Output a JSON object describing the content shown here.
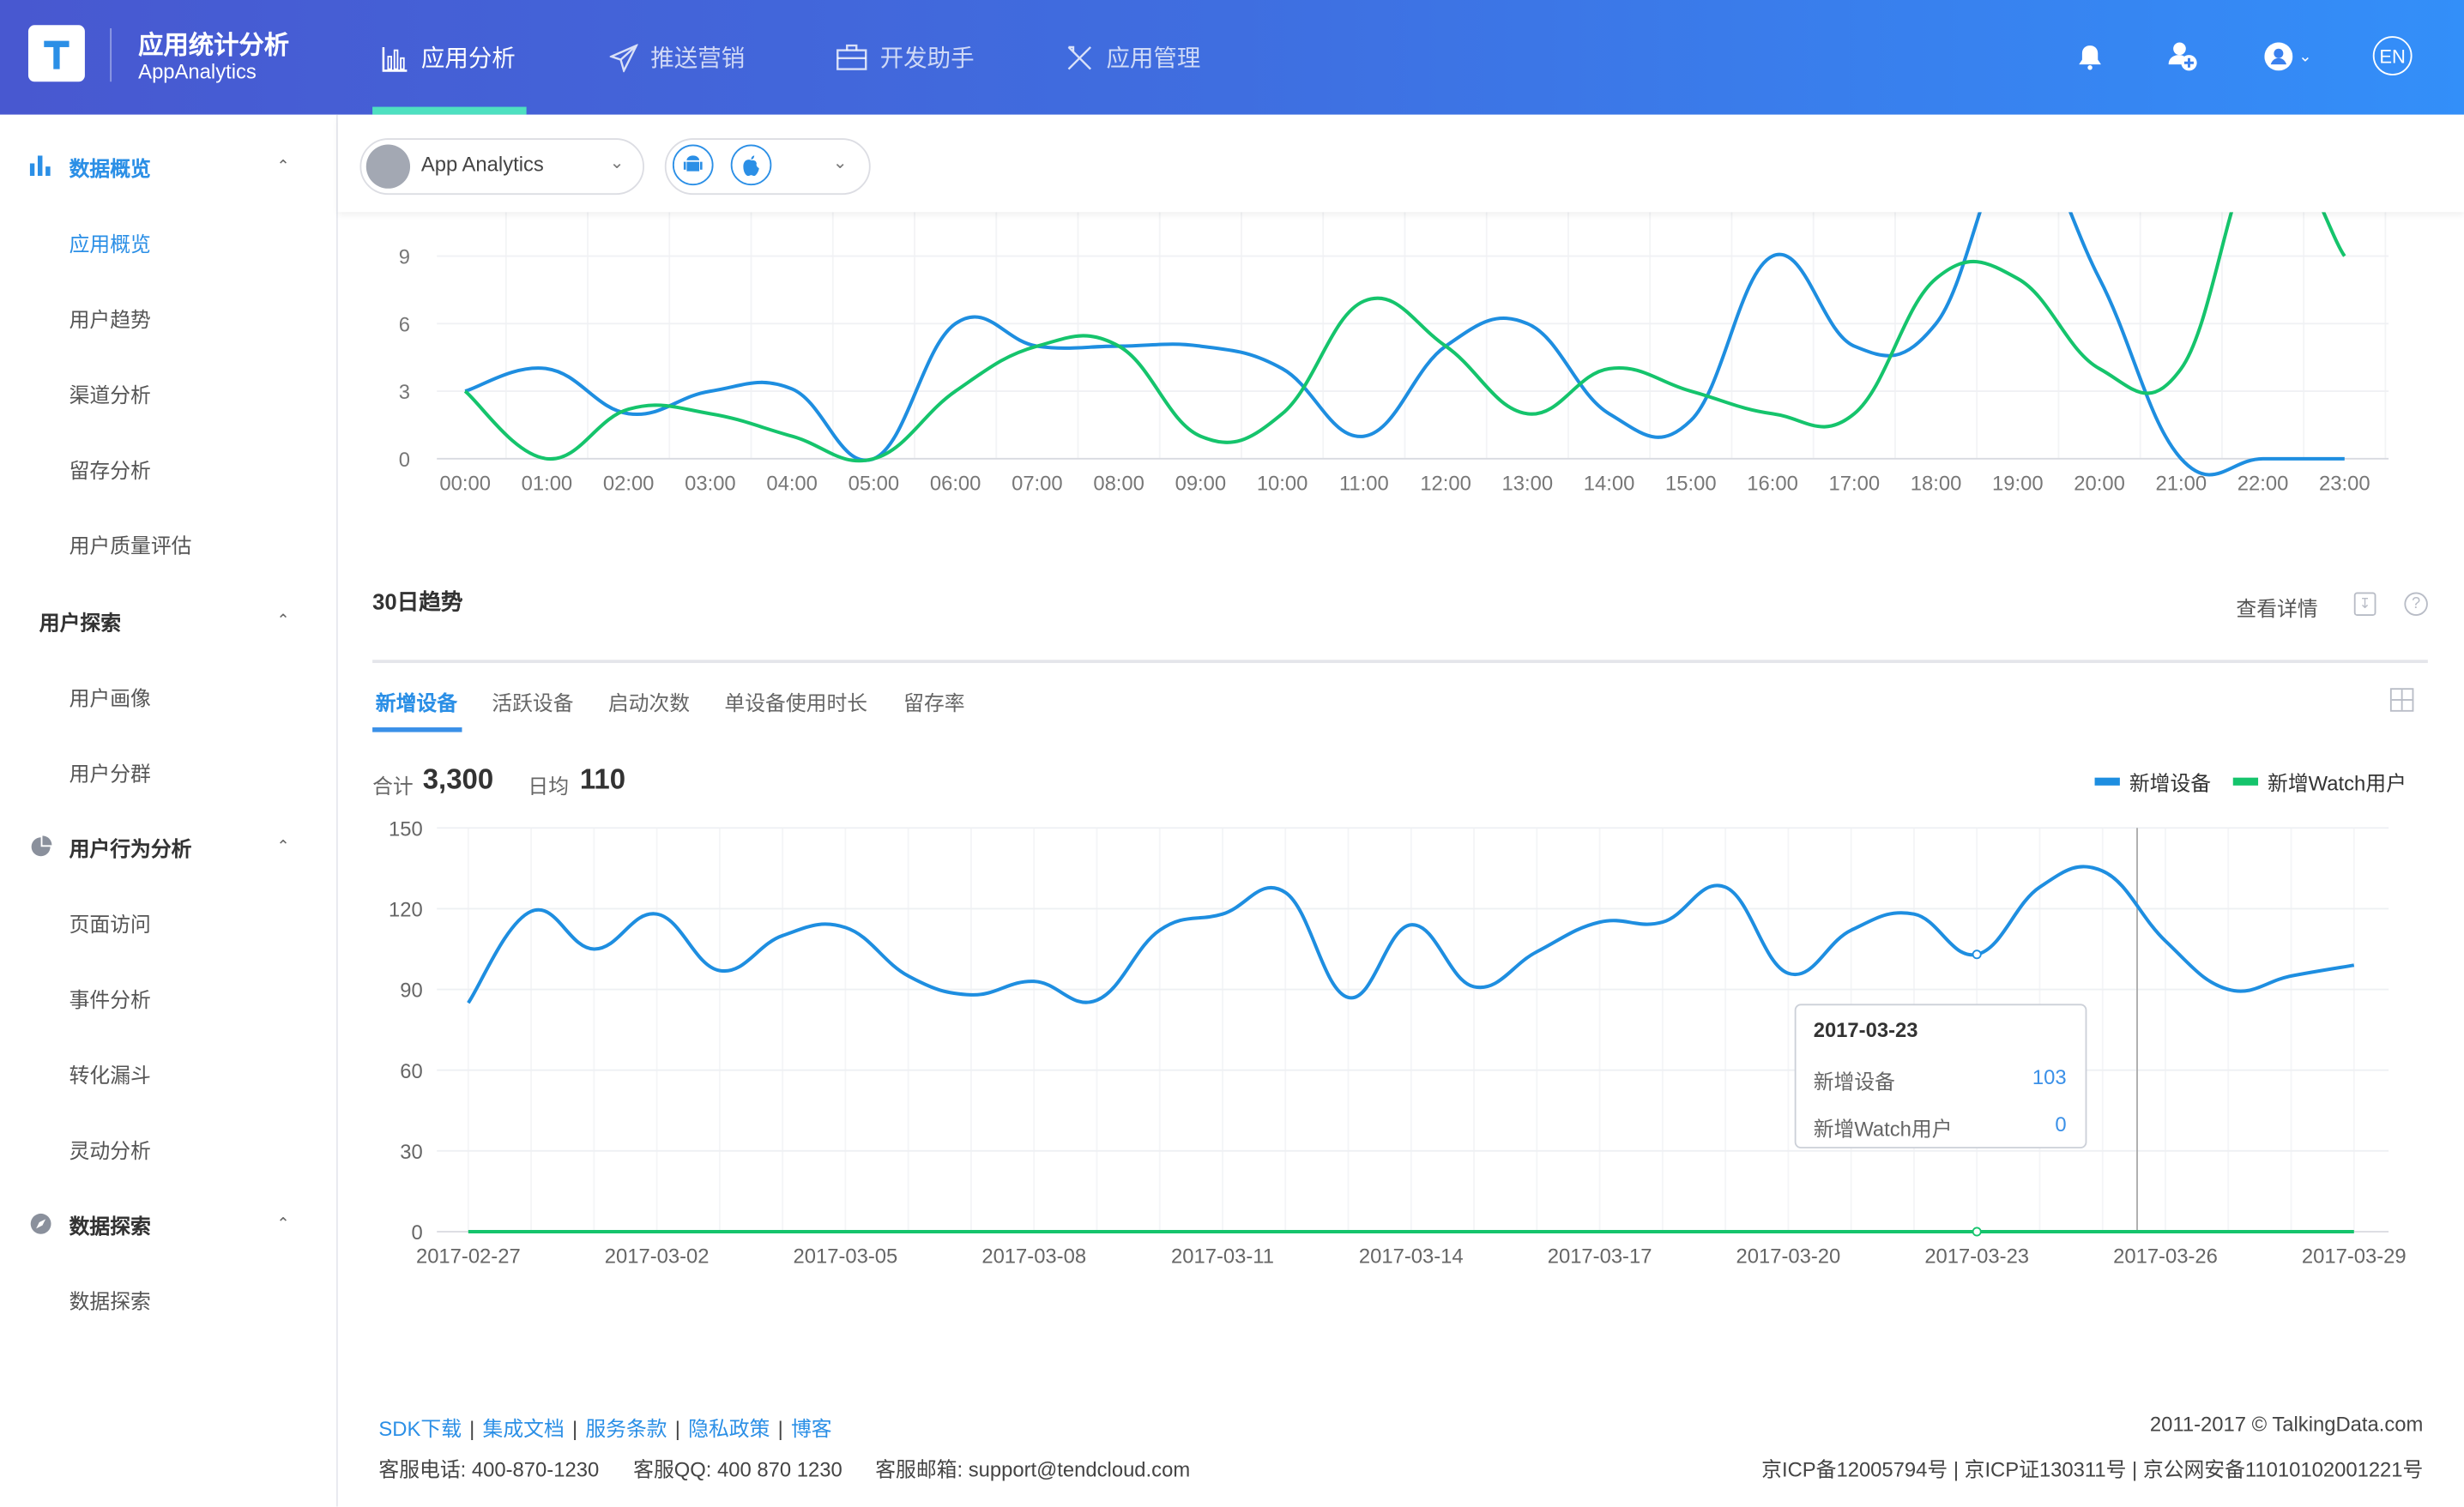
{
  "header": {
    "brand_cn": "应用统计分析",
    "brand_en": "AppAnalytics",
    "nav": [
      {
        "label": "应用分析",
        "icon": "bar-chart-icon"
      },
      {
        "label": "推送营销",
        "icon": "paper-plane-icon"
      },
      {
        "label": "开发助手",
        "icon": "briefcase-icon"
      },
      {
        "label": "应用管理",
        "icon": "tools-icon"
      }
    ],
    "lang": "EN"
  },
  "sidebar": {
    "sections": [
      {
        "label": "数据概览",
        "icon": "bar-chart-icon",
        "items": [
          "应用概览",
          "用户趋势",
          "渠道分析",
          "留存分析",
          "用户质量评估"
        ]
      },
      {
        "label": "用户探索",
        "items": [
          "用户画像",
          "用户分群"
        ]
      },
      {
        "label": "用户行为分析",
        "icon": "pie-chart-icon",
        "items": [
          "页面访问",
          "事件分析",
          "转化漏斗",
          "灵动分析"
        ]
      },
      {
        "label": "数据探索",
        "icon": "compass-icon",
        "items": [
          "数据探索"
        ]
      }
    ],
    "active_item": "应用概览"
  },
  "app_selector": {
    "value": "App Analytics"
  },
  "platform_selector": {
    "options": [
      "android",
      "ios"
    ]
  },
  "colors": {
    "blue": "#1e8ee0",
    "green": "#15c46c",
    "accent": "#2b8fe6"
  },
  "chart_data": [
    {
      "type": "line",
      "x": [
        "00:00",
        "01:00",
        "02:00",
        "03:00",
        "04:00",
        "05:00",
        "06:00",
        "07:00",
        "08:00",
        "09:00",
        "10:00",
        "11:00",
        "12:00",
        "13:00",
        "14:00",
        "15:00",
        "16:00",
        "17:00",
        "18:00",
        "19:00",
        "20:00",
        "21:00",
        "22:00",
        "23:00"
      ],
      "yticks": [
        0,
        3,
        6,
        9
      ],
      "ylim_visible": [
        0,
        11
      ],
      "grid": true,
      "series": [
        {
          "color": "#1e8ee0",
          "values": [
            3,
            4,
            2,
            3,
            3.1,
            0,
            6,
            5,
            5,
            5,
            4,
            1,
            5,
            6,
            2,
            1.7,
            9,
            5,
            6,
            14,
            8,
            0,
            0,
            0
          ]
        },
        {
          "color": "#15c46c",
          "values": [
            3,
            0,
            2.2,
            2,
            1,
            0,
            3,
            5,
            5,
            1,
            2,
            7,
            5,
            2,
            4,
            3,
            2,
            2,
            8,
            8,
            4,
            4,
            14,
            9
          ]
        }
      ]
    },
    {
      "type": "line",
      "title": "30日趋势",
      "x": [
        "2017-02-27",
        "2017-02-28",
        "2017-03-01",
        "2017-03-02",
        "2017-03-03",
        "2017-03-04",
        "2017-03-05",
        "2017-03-06",
        "2017-03-07",
        "2017-03-08",
        "2017-03-09",
        "2017-03-10",
        "2017-03-11",
        "2017-03-12",
        "2017-03-13",
        "2017-03-14",
        "2017-03-15",
        "2017-03-16",
        "2017-03-17",
        "2017-03-18",
        "2017-03-19",
        "2017-03-20",
        "2017-03-21",
        "2017-03-22",
        "2017-03-23",
        "2017-03-24",
        "2017-03-25",
        "2017-03-26",
        "2017-03-27",
        "2017-03-28",
        "2017-03-29"
      ],
      "xtick_labels": [
        "2017-02-27",
        "2017-03-02",
        "2017-03-05",
        "2017-03-08",
        "2017-03-11",
        "2017-03-14",
        "2017-03-17",
        "2017-03-20",
        "2017-03-23",
        "2017-03-26",
        "2017-03-29"
      ],
      "yticks": [
        0,
        30,
        60,
        90,
        120,
        150
      ],
      "ylim": [
        0,
        150
      ],
      "grid": true,
      "legend": "top-right",
      "series": [
        {
          "name": "新增设备",
          "color": "#1e8ee0",
          "values": [
            85,
            119,
            105,
            118,
            97,
            110,
            113,
            95,
            88,
            93,
            86,
            112,
            118,
            126,
            87,
            114,
            91,
            104,
            115,
            115,
            128,
            96,
            112,
            118,
            103,
            128,
            134,
            108,
            90,
            95,
            99
          ]
        },
        {
          "name": "新增Watch用户",
          "color": "#15c46c",
          "values": [
            0,
            0,
            0,
            0,
            0,
            0,
            0,
            0,
            0,
            0,
            0,
            0,
            0,
            0,
            0,
            0,
            0,
            0,
            0,
            0,
            0,
            0,
            0,
            0,
            0,
            0,
            0,
            0,
            0,
            0,
            0
          ]
        }
      ]
    }
  ],
  "trend": {
    "title": "30日趋势",
    "detail_link": "查看详情",
    "tabs": [
      "新增设备",
      "活跃设备",
      "启动次数",
      "单设备使用时长",
      "留存率"
    ],
    "active_tab": "新增设备",
    "total_label": "合计",
    "total": "3,300",
    "avg_label": "日均",
    "avg": "110",
    "legend": [
      "新增设备",
      "新增Watch用户"
    ],
    "tooltip": {
      "date": "2017-03-23",
      "rows": [
        {
          "label": "新增设备",
          "value": "103"
        },
        {
          "label": "新增Watch用户",
          "value": "0"
        }
      ]
    }
  },
  "footer": {
    "links": [
      "SDK下载",
      "集成文档",
      "服务条款",
      "隐私政策",
      "博客"
    ],
    "copyright": "2011-2017 © TalkingData.com",
    "phone": "客服电话: 400-870-1230",
    "qq": "客服QQ: 400 870 1230",
    "email": "客服邮箱: support@tendcloud.com",
    "icp": "京ICP备12005794号 | 京ICP证130311号 | 京公网安备11010102001221号"
  }
}
